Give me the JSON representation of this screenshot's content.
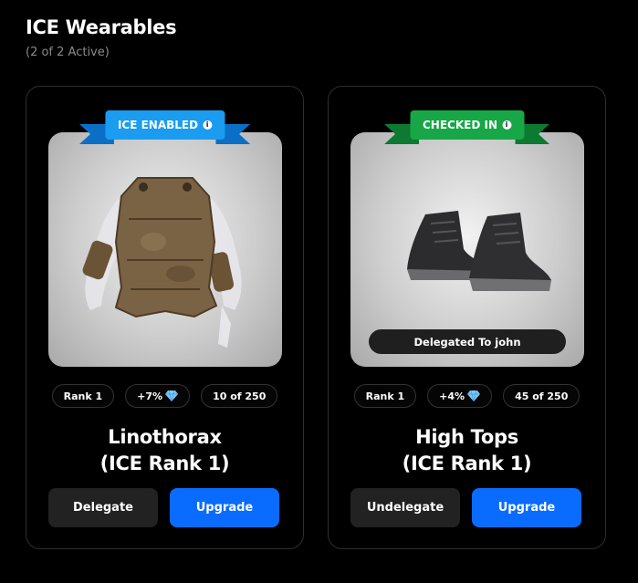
{
  "header": {
    "title": "ICE Wearables",
    "subtitle": "(2 of 2 Active)"
  },
  "cards": [
    {
      "badge": "ICE ENABLED",
      "badge_color": "#1a9cf0",
      "delegated_label": "",
      "stats": {
        "rank": "Rank 1",
        "bonus": "+7%",
        "supply": "10 of 250"
      },
      "name_line1": "Linothorax",
      "name_line2": "(ICE Rank 1)",
      "primary_action": "Delegate",
      "secondary_action": "Upgrade",
      "image_icon": "leather-armor-icon"
    },
    {
      "badge": "CHECKED IN",
      "badge_color": "#17a746",
      "delegated_label": "Delegated To john",
      "stats": {
        "rank": "Rank 1",
        "bonus": "+4%",
        "supply": "45 of 250"
      },
      "name_line1": "High Tops",
      "name_line2": "(ICE Rank 1)",
      "primary_action": "Undelegate",
      "secondary_action": "Upgrade",
      "image_icon": "sneakers-icon"
    }
  ],
  "colors": {
    "accent": "#0a6cff",
    "dark_button": "#222222"
  }
}
